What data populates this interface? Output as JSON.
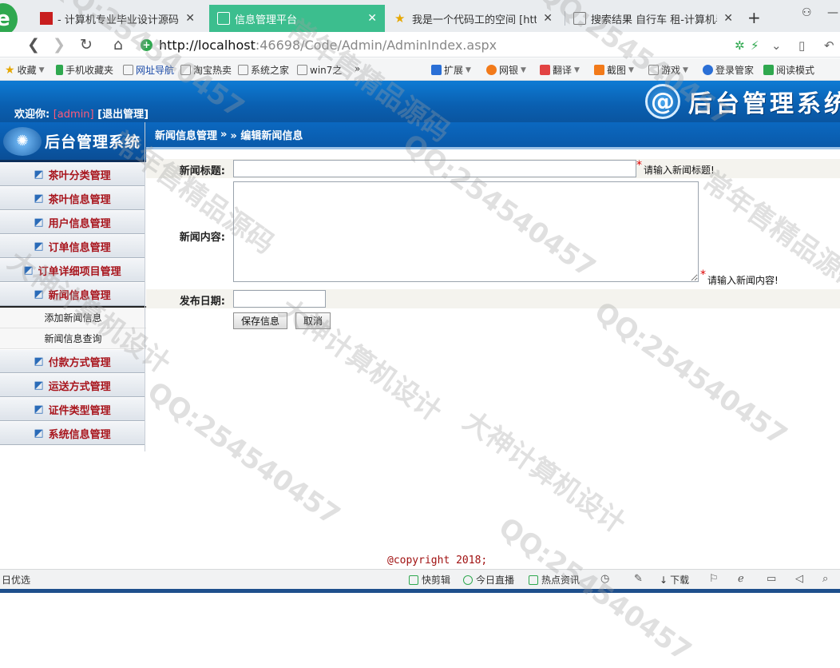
{
  "browser": {
    "tabs": [
      {
        "title": "- 计算机专业毕业设计源码网",
        "active": false
      },
      {
        "title": "信息管理平台",
        "active": true
      },
      {
        "title": "我是一个代码工的空间 [http:/",
        "active": false
      },
      {
        "title": "搜索结果 自行车 租-计算机毕业",
        "active": false
      }
    ],
    "new_tab": "+",
    "url_host": "http://localhost",
    "url_rest": ":46698/Code/Admin/AdminIndex.aspx",
    "bookmarks": [
      {
        "label": "收藏",
        "icon": "star-icon",
        "caret": true
      },
      {
        "label": "手机收藏夹",
        "icon": "phone-icon",
        "caret": false
      },
      {
        "label": "网址导航",
        "icon": "page-icon",
        "caret": false
      },
      {
        "label": "淘宝热卖",
        "icon": "page-icon",
        "caret": false
      },
      {
        "label": "系统之家",
        "icon": "page-icon",
        "caret": false
      },
      {
        "label": "win7之",
        "icon": "page-icon",
        "caret": false
      },
      {
        "label": "»",
        "icon": "",
        "caret": false
      }
    ],
    "tools": [
      {
        "label": "扩展",
        "icon": "grid-icon"
      },
      {
        "label": "网银",
        "icon": "bank-icon"
      },
      {
        "label": "翻译",
        "icon": "translate-icon"
      },
      {
        "label": "截图",
        "icon": "scissors-icon"
      },
      {
        "label": "游戏",
        "icon": "game-icon"
      },
      {
        "label": "登录管家",
        "icon": "key-icon"
      },
      {
        "label": "阅读模式",
        "icon": "book-icon"
      }
    ],
    "status": {
      "left": "日优选",
      "items": [
        "快剪辑",
        "今日直播",
        "热点资讯",
        "下载"
      ]
    }
  },
  "header": {
    "welcome_label": "欢迎你:",
    "username": "[admin]",
    "logout": "[退出管理]",
    "system_title": "后台管理系统",
    "logo_char": "@"
  },
  "sidebar": {
    "title": "后台管理系统",
    "items": [
      {
        "label": "茶叶分类管理"
      },
      {
        "label": "茶叶信息管理"
      },
      {
        "label": "用户信息管理"
      },
      {
        "label": "订单信息管理"
      },
      {
        "label": "订单详细项目管理"
      },
      {
        "label": "新闻信息管理"
      }
    ],
    "submenu": [
      {
        "label": "添加新闻信息"
      },
      {
        "label": "新闻信息查询"
      }
    ],
    "items_after": [
      {
        "label": "付款方式管理"
      },
      {
        "label": "运送方式管理"
      },
      {
        "label": "证件类型管理"
      },
      {
        "label": "系统信息管理"
      }
    ]
  },
  "breadcrumb": {
    "section": "新闻信息管理",
    "separator": "»",
    "current": "» 编辑新闻信息"
  },
  "form": {
    "title_label": "新闻标题:",
    "title_value": "",
    "title_hint": "请输入新闻标题!",
    "content_label": "新闻内容:",
    "content_value": "",
    "content_hint": "请输入新闻内容!",
    "date_label": "发布日期:",
    "date_value": "",
    "required_mark": "*",
    "save_button": "保存信息",
    "cancel_button": "取消"
  },
  "footer": {
    "copyright": "@copyright 2018;"
  },
  "watermarks": [
    "大神计算机设计",
    "QQ:254540457",
    "常年售精品源码"
  ]
}
